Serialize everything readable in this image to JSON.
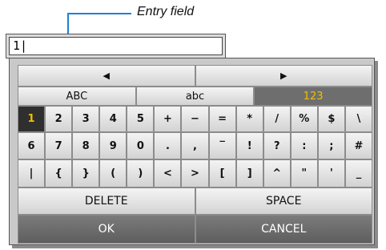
{
  "callout": {
    "label": "Entry field"
  },
  "entry": {
    "value": "1|"
  },
  "nav": {
    "left_label": "◀",
    "right_label": "▶"
  },
  "modes": [
    {
      "label": "ABC",
      "selected": false
    },
    {
      "label": "abc",
      "selected": false
    },
    {
      "label": "123",
      "selected": true
    }
  ],
  "rows": [
    [
      "1",
      "2",
      "3",
      "4",
      "5",
      "+",
      "−",
      "=",
      "*",
      "/",
      "%",
      "$",
      "\\"
    ],
    [
      "6",
      "7",
      "8",
      "9",
      "0",
      ".",
      ",",
      "‾",
      "!",
      "?",
      ":",
      ";",
      "#"
    ],
    [
      "|",
      "{",
      "}",
      "(",
      ")",
      "<",
      ">",
      "[",
      "]",
      "^",
      "\"",
      "'",
      "_"
    ]
  ],
  "selected_key": "1",
  "actions": {
    "delete_label": "DELETE",
    "space_label": "SPACE"
  },
  "footer": {
    "ok_label": "OK",
    "cancel_label": "CANCEL"
  },
  "colors": {
    "accent": "#f0c000",
    "callout": "#1f7fd6"
  }
}
